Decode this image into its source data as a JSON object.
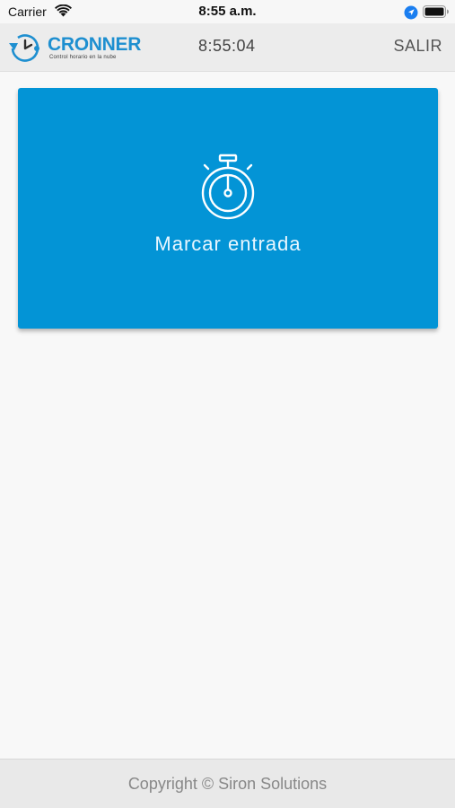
{
  "status_bar": {
    "carrier": "Carrier",
    "time": "8:55 a.m.",
    "icons": [
      "wifi-icon",
      "location-icon",
      "battery-icon"
    ]
  },
  "header": {
    "logo_text": "CRONNER",
    "logo_tagline": "Control horario en la nube",
    "current_time": "8:55:04",
    "logout_label": "SALIR"
  },
  "main": {
    "action_label": "Marcar entrada",
    "action_icon": "stopwatch-icon",
    "card_color": "#0394d6"
  },
  "footer": {
    "copyright": "Copyright © Siron Solutions"
  },
  "colors": {
    "brand": "#1e8fd0",
    "accent": "#0394d6"
  }
}
